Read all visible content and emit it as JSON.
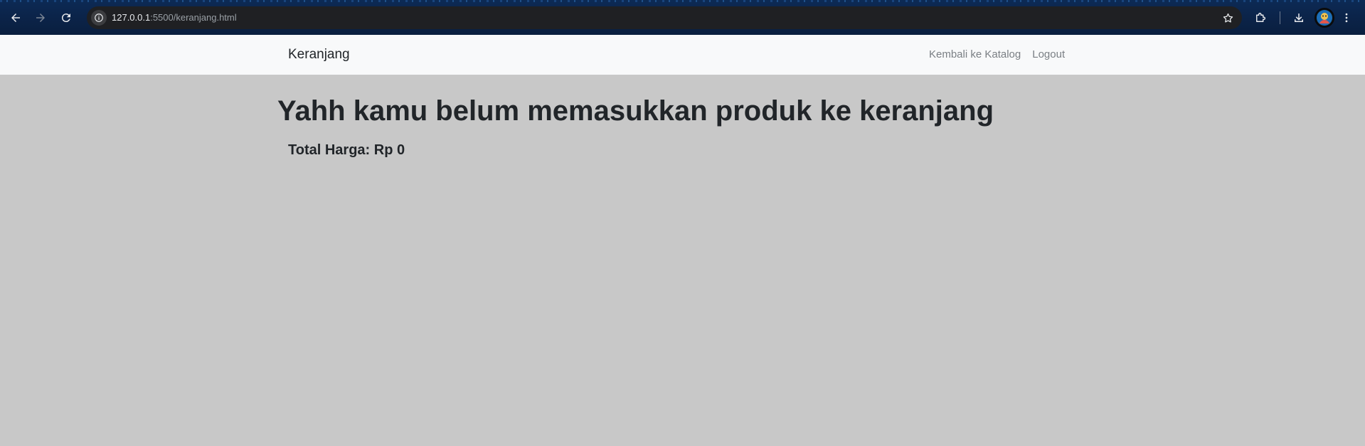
{
  "browser": {
    "url_host": "127.0.0.1",
    "url_rest": ":5500/keranjang.html",
    "icons": {
      "back": "arrow-left-icon",
      "forward": "arrow-right-icon",
      "reload": "reload-icon",
      "site_info": "info-icon",
      "bookmark": "star-icon",
      "extensions": "puzzle-icon",
      "downloads": "download-icon",
      "profile": "avatar",
      "menu": "kebab-menu-icon"
    }
  },
  "navbar": {
    "brand": "Keranjang",
    "links": [
      {
        "label": "Kembali ke Katalog"
      },
      {
        "label": "Logout"
      }
    ]
  },
  "cart": {
    "empty_message": "Yahh kamu belum memasukkan produk ke keranjang",
    "total_label": "Total Harga: Rp 0"
  },
  "colors": {
    "page_background": "#c8c8c8",
    "navbar_background": "#f8f9fa",
    "text_dark": "#212529",
    "nav_link": "#7a7f84",
    "browser_frame": "#0c2a55",
    "omnibox": "#1f2023"
  }
}
